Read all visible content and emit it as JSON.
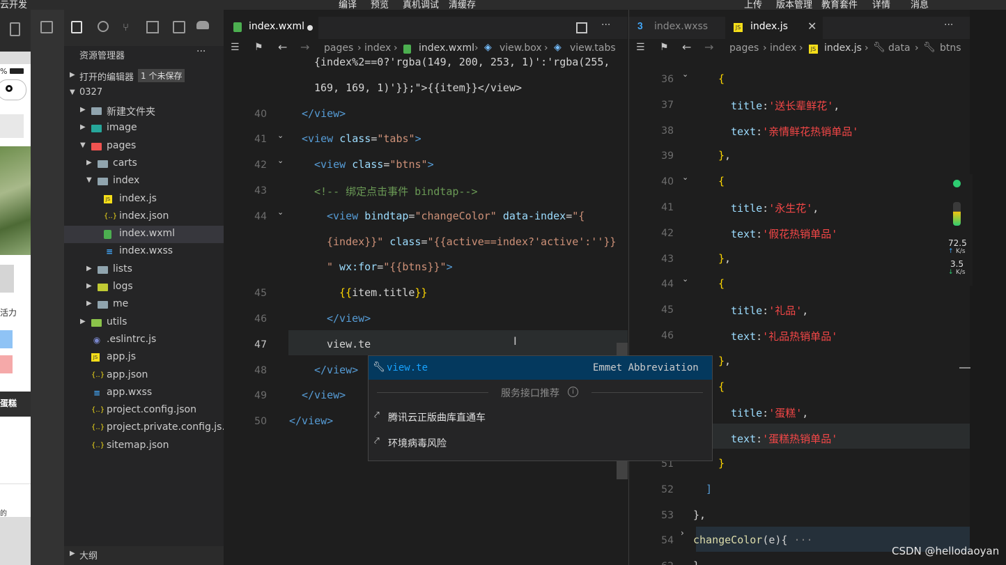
{
  "menubar": {
    "app_title": "云开发",
    "menu": [
      "编译",
      "预览",
      "真机调试",
      "清缓存"
    ],
    "right_menu": [
      "上传",
      "版本管理",
      "教育套件",
      "详情",
      "消息"
    ]
  },
  "simulator": {
    "battery": "%",
    "text1": "活力",
    "text2": "蛋糕",
    "text3": "的"
  },
  "explorer": {
    "title": "资源管理器",
    "more": "···",
    "open_editors": "打开的编辑器",
    "unsaved_badge": "1 个未保存",
    "root": "0327",
    "bottom_label": "大纲",
    "tree": [
      {
        "label": "新建文件夹",
        "depth": 1,
        "kind": "folder",
        "open": false
      },
      {
        "label": "image",
        "depth": 1,
        "kind": "folder-image",
        "open": false
      },
      {
        "label": "pages",
        "depth": 1,
        "kind": "folder-pages",
        "open": true
      },
      {
        "label": "carts",
        "depth": 2,
        "kind": "folder",
        "open": false
      },
      {
        "label": "index",
        "depth": 2,
        "kind": "folder",
        "open": true
      },
      {
        "label": "index.js",
        "depth": 3,
        "kind": "js"
      },
      {
        "label": "index.json",
        "depth": 3,
        "kind": "json"
      },
      {
        "label": "index.wxml",
        "depth": 3,
        "kind": "wxml",
        "selected": true
      },
      {
        "label": "index.wxss",
        "depth": 3,
        "kind": "wxss"
      },
      {
        "label": "lists",
        "depth": 2,
        "kind": "folder",
        "open": false
      },
      {
        "label": "logs",
        "depth": 2,
        "kind": "folder-logs",
        "open": false
      },
      {
        "label": "me",
        "depth": 2,
        "kind": "folder",
        "open": false
      },
      {
        "label": "utils",
        "depth": 1,
        "kind": "folder-utils",
        "open": false
      },
      {
        "label": ".eslintrc.js",
        "depth": 1,
        "kind": "eslint"
      },
      {
        "label": "app.js",
        "depth": 1,
        "kind": "js"
      },
      {
        "label": "app.json",
        "depth": 1,
        "kind": "json"
      },
      {
        "label": "app.wxss",
        "depth": 1,
        "kind": "wxss"
      },
      {
        "label": "project.config.json",
        "depth": 1,
        "kind": "json"
      },
      {
        "label": "project.private.config.js...",
        "depth": 1,
        "kind": "json"
      },
      {
        "label": "sitemap.json",
        "depth": 1,
        "kind": "json"
      }
    ]
  },
  "editor1": {
    "tab_label": "index.wxml",
    "breadcrumb": [
      "pages",
      "index",
      "index.wxml",
      "view.box",
      "view.tabs"
    ],
    "lines": [
      {
        "n": "",
        "indent": 2,
        "segs": [
          [
            "txt",
            "{index%2==0?'rgba(149, 200, 253, 1)':'rgba(255,"
          ]
        ]
      },
      {
        "n": "",
        "indent": 2,
        "segs": [
          [
            "txt",
            "169, 169, 1)'}};\">{{item}}</view>"
          ]
        ]
      },
      {
        "n": "40",
        "indent": 1,
        "segs": [
          [
            "tag",
            "</view>"
          ]
        ]
      },
      {
        "n": "41",
        "indent": 1,
        "segs": [
          [
            "tag",
            "<view "
          ],
          [
            "attr",
            "class"
          ],
          [
            "txt",
            "="
          ],
          [
            "str",
            "\"tabs\""
          ],
          [
            "tag",
            ">"
          ]
        ]
      },
      {
        "n": "42",
        "indent": 2,
        "segs": [
          [
            "tag",
            "<view "
          ],
          [
            "attr",
            "class"
          ],
          [
            "txt",
            "="
          ],
          [
            "str",
            "\"btns\""
          ],
          [
            "tag",
            ">"
          ]
        ]
      },
      {
        "n": "43",
        "indent": 2,
        "segs": [
          [
            "cmt",
            "<!-- 绑定点击事件 bindtap-->"
          ]
        ]
      },
      {
        "n": "44",
        "indent": 3,
        "segs": [
          [
            "tag",
            "<view "
          ],
          [
            "attr",
            "bindtap"
          ],
          [
            "txt",
            "="
          ],
          [
            "str",
            "\"changeColor\""
          ],
          [
            "attr",
            " data-index"
          ],
          [
            "txt",
            "="
          ],
          [
            "str",
            "\"{"
          ]
        ]
      },
      {
        "n": "",
        "indent": 3,
        "segs": [
          [
            "str",
            "{index}}\""
          ],
          [
            "attr",
            " class"
          ],
          [
            "txt",
            "="
          ],
          [
            "str",
            "\"{{active==index?'active':''}}"
          ]
        ]
      },
      {
        "n": "",
        "indent": 3,
        "segs": [
          [
            "str",
            "\""
          ],
          [
            "attr",
            " wx:for"
          ],
          [
            "txt",
            "="
          ],
          [
            "str",
            "\"{{btns}}\""
          ],
          [
            "tag",
            ">"
          ]
        ]
      },
      {
        "n": "45",
        "indent": 4,
        "segs": [
          [
            "brace",
            "{{"
          ],
          [
            "txt",
            "item.title"
          ],
          [
            "brace",
            "}}"
          ]
        ]
      },
      {
        "n": "46",
        "indent": 3,
        "segs": [
          [
            "tag",
            "</view>"
          ]
        ]
      },
      {
        "n": "47",
        "indent": 3,
        "segs": [
          [
            "txt",
            "view.te"
          ]
        ]
      },
      {
        "n": "48",
        "indent": 2,
        "segs": [
          [
            "tag",
            "</view>"
          ]
        ]
      },
      {
        "n": "49",
        "indent": 1,
        "segs": [
          [
            "tag",
            "</view>"
          ]
        ]
      },
      {
        "n": "50",
        "indent": 0,
        "segs": [
          [
            "tag",
            "</view>"
          ]
        ]
      }
    ]
  },
  "suggest": {
    "item": "view.te",
    "item_type": "Emmet Abbreviation",
    "section": "服务接口推荐",
    "links": [
      "腾讯云正版曲库直通车",
      "环境病毒风险"
    ]
  },
  "editor2": {
    "tab_inactive": "index.wxss",
    "tab_active": "index.js",
    "breadcrumb": [
      "pages",
      "index",
      "index.js",
      "data",
      "btns"
    ],
    "lines": [
      {
        "n": "36",
        "indent": 1,
        "segs": [
          [
            "brace",
            "{"
          ]
        ]
      },
      {
        "n": "37",
        "indent": 2,
        "segs": [
          [
            "key",
            "title"
          ],
          [
            "txt",
            ":"
          ],
          [
            "jstr",
            "'送长辈鲜花'"
          ],
          [
            "txt",
            ","
          ]
        ]
      },
      {
        "n": "38",
        "indent": 2,
        "segs": [
          [
            "key",
            "text"
          ],
          [
            "txt",
            ":"
          ],
          [
            "jstr",
            "'亲情鲜花热销单品'"
          ]
        ]
      },
      {
        "n": "39",
        "indent": 1,
        "segs": [
          [
            "brace",
            "}"
          ],
          [
            "txt",
            ","
          ]
        ]
      },
      {
        "n": "40",
        "indent": 1,
        "segs": [
          [
            "brace",
            "{"
          ]
        ]
      },
      {
        "n": "41",
        "indent": 2,
        "segs": [
          [
            "key",
            "title"
          ],
          [
            "txt",
            ":"
          ],
          [
            "jstr",
            "'永生花'"
          ],
          [
            "txt",
            ","
          ]
        ]
      },
      {
        "n": "42",
        "indent": 2,
        "segs": [
          [
            "key",
            "text"
          ],
          [
            "txt",
            ":"
          ],
          [
            "jstr",
            "'假花热销单品'"
          ]
        ]
      },
      {
        "n": "43",
        "indent": 1,
        "segs": [
          [
            "brace",
            "}"
          ],
          [
            "txt",
            ","
          ]
        ]
      },
      {
        "n": "44",
        "indent": 1,
        "segs": [
          [
            "brace",
            "{"
          ]
        ]
      },
      {
        "n": "45",
        "indent": 2,
        "segs": [
          [
            "key",
            "title"
          ],
          [
            "txt",
            ":"
          ],
          [
            "jstr",
            "'礼品'"
          ],
          [
            "txt",
            ","
          ]
        ]
      },
      {
        "n": "46",
        "indent": 2,
        "segs": [
          [
            "key",
            "text"
          ],
          [
            "txt",
            ":"
          ],
          [
            "jstr",
            "'礼品热销单品'"
          ]
        ]
      },
      {
        "n": "47",
        "indent": 1,
        "segs": [
          [
            "brace",
            "}"
          ],
          [
            "txt",
            ","
          ]
        ]
      },
      {
        "n": "48",
        "indent": 1,
        "segs": [
          [
            "brace",
            "{"
          ]
        ]
      },
      {
        "n": "49",
        "indent": 2,
        "segs": [
          [
            "key",
            "title"
          ],
          [
            "txt",
            ":"
          ],
          [
            "jstr",
            "'蛋糕'"
          ],
          [
            "txt",
            ","
          ]
        ]
      },
      {
        "n": "50",
        "indent": 2,
        "segs": [
          [
            "key",
            "text"
          ],
          [
            "txt",
            ":"
          ],
          [
            "jstr",
            "'蛋糕热销单品'"
          ]
        ]
      },
      {
        "n": "51",
        "indent": 1,
        "segs": [
          [
            "brace",
            "}"
          ]
        ]
      },
      {
        "n": "52",
        "indent": 0,
        "segs": [
          [
            "tag",
            "]"
          ]
        ]
      },
      {
        "n": "53",
        "indent": -1,
        "segs": [
          [
            "txt",
            "},"
          ]
        ]
      },
      {
        "n": "54",
        "indent": -1,
        "segs": [
          [
            "fn",
            "changeColor"
          ],
          [
            "txt",
            "(e){ "
          ],
          [
            "dim",
            "···"
          ]
        ]
      },
      {
        "n": "62",
        "indent": -1,
        "segs": [
          [
            "txt",
            "}"
          ]
        ]
      }
    ]
  },
  "netspeed": {
    "up": "72.5",
    "up_unit": "K/s",
    "down": "3.5",
    "down_unit": "K/s"
  },
  "watermark": "CSDN @hellodaoyan"
}
